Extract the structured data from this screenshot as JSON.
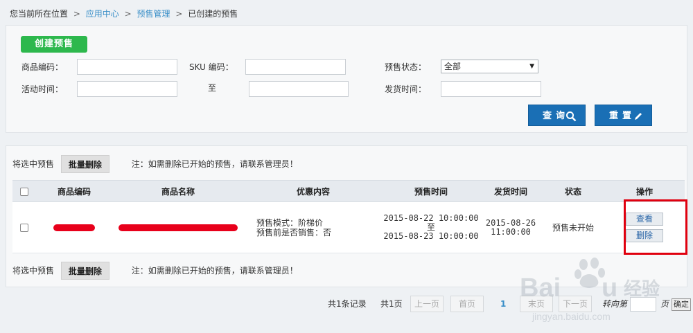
{
  "breadcrumb": {
    "prefix": "您当前所在位置",
    "items": [
      "应用中心",
      "预售管理",
      "已创建的预售"
    ],
    "separator": ">"
  },
  "filters": {
    "create_button": "创建预售",
    "product_code_label": "商品编码：",
    "sku_code_label": "SKU 编码：",
    "presale_status_label": "预售状态：",
    "presale_status_value": "全部",
    "activity_time_label": "活动时间：",
    "to_label": "至",
    "ship_time_label": "发货时间：",
    "search_button": "查询",
    "reset_button": "重置"
  },
  "bulk": {
    "select_label": "将选中预售",
    "delete_button": "批量删除",
    "note": "注：如需删除已开始的预售，请联系管理员！"
  },
  "table": {
    "headers": [
      "商品编码",
      "商品名称",
      "优惠内容",
      "预售时间",
      "发货时间",
      "状态",
      "操作"
    ],
    "rows": [
      {
        "discount_line1": "预售模式：阶梯价",
        "discount_line2": "预售前是否销售：否",
        "presale_start": "2015-08-22 10:00:00",
        "presale_to": "至",
        "presale_end": "2015-08-23 10:00:00",
        "ship_date": "2015-08-26",
        "ship_time": "11:00:00",
        "status": "预售未开始",
        "view_button": "查看",
        "delete_button": "删除"
      }
    ]
  },
  "pagination": {
    "total_records": "共1条记录",
    "total_pages": "共1页",
    "prev": "上一页",
    "first": "首页",
    "current_page": "1",
    "last": "末页",
    "next": "下一页",
    "goto_label": "转向第",
    "page_suffix": "页",
    "confirm": "确定"
  },
  "watermark": {
    "brand": "Baidu",
    "suffix": "经验",
    "url": "jingyan.baidu.com"
  },
  "colors": {
    "accent_green": "#2db84d",
    "accent_blue": "#1a6fb5",
    "link_blue": "#3a8fc8",
    "highlight_red": "#e0000f"
  }
}
